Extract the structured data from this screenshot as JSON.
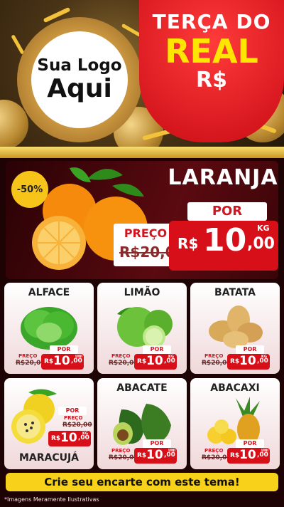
{
  "logo": {
    "line1": "Sua Logo",
    "line2": "Aqui"
  },
  "promo": {
    "line1": "TERÇA DO",
    "line2": "REAL",
    "line3": "R$"
  },
  "hero": {
    "discount": "-50%",
    "product": "LARANJA",
    "por_label": "POR",
    "preco_label": "PREÇO",
    "old_price": "R$20,00",
    "currency": "R$",
    "price_int": "10",
    "price_dec": ",00",
    "unit": "KG"
  },
  "products": [
    {
      "name": "ALFACE",
      "por": "POR",
      "preco": "PREÇO",
      "old": "R$20,00",
      "currency": "R$",
      "int": "10",
      "dec": ",00",
      "unit": "UNI"
    },
    {
      "name": "LIMÃO",
      "por": "POR",
      "preco": "PREÇO",
      "old": "R$20,00",
      "currency": "R$",
      "int": "10",
      "dec": ",00",
      "unit": "KG"
    },
    {
      "name": "BATATA",
      "por": "POR",
      "preco": "PREÇO",
      "old": "R$20,00",
      "currency": "R$",
      "int": "10",
      "dec": ",00",
      "unit": "KG"
    },
    {
      "name": "MARACUJÁ",
      "por": "POR",
      "preco": "PREÇO",
      "old": "R$20,00",
      "currency": "R$",
      "int": "10",
      "dec": ",00",
      "unit": "KG"
    },
    {
      "name": "ABACATE",
      "por": "POR",
      "preco": "PREÇO",
      "old": "R$20,00",
      "currency": "R$",
      "int": "10",
      "dec": ",00",
      "unit": "UNI"
    },
    {
      "name": "ABACAXI",
      "por": "POR",
      "preco": "PREÇO",
      "old": "R$20,00",
      "currency": "R$",
      "int": "10",
      "dec": ",00",
      "unit": "UNI"
    }
  ],
  "cta": "Crie seu encarte com este tema!",
  "note": "*Imagens Meramente Ilustrativas",
  "colors": {
    "red": "#d70f19",
    "yellow": "#f7d11a",
    "dark": "#1e0305",
    "gold": "#c99520"
  }
}
